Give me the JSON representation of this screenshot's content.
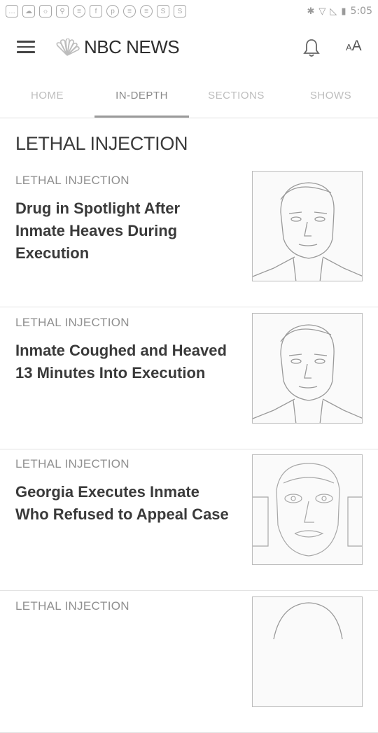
{
  "status_bar": {
    "time": "5:05",
    "icons": [
      "message-icon",
      "cloud-icon",
      "weather-icon",
      "search-icon",
      "reader-icon",
      "facebook-icon",
      "pinterest-icon",
      "reader-icon",
      "reader-icon",
      "shazam-icon",
      "shazam-icon"
    ],
    "right_icons": [
      "bluetooth-icon",
      "wifi-icon",
      "signal-icon",
      "battery-icon"
    ]
  },
  "app_bar": {
    "logo_text": "NBC NEWS",
    "font_small": "A",
    "font_big": "A"
  },
  "tabs": [
    {
      "label": "HOME",
      "active": false
    },
    {
      "label": "IN-DEPTH",
      "active": true
    },
    {
      "label": "SECTIONS",
      "active": false
    },
    {
      "label": "SHOWS",
      "active": false
    }
  ],
  "section_title": "LETHAL INJECTION",
  "articles": [
    {
      "eyebrow": "LETHAL INJECTION",
      "headline": "Drug in Spotlight After Inmate Heaves During Execution"
    },
    {
      "eyebrow": "LETHAL INJECTION",
      "headline": "Inmate Coughed and Heaved 13 Minutes Into Execution"
    },
    {
      "eyebrow": "LETHAL INJECTION",
      "headline": "Georgia Executes Inmate Who Refused to Appeal Case"
    },
    {
      "eyebrow": "LETHAL INJECTION",
      "headline": ""
    }
  ],
  "colors": {
    "accent": "#9a9a9a",
    "text": "#3a3a3a"
  }
}
